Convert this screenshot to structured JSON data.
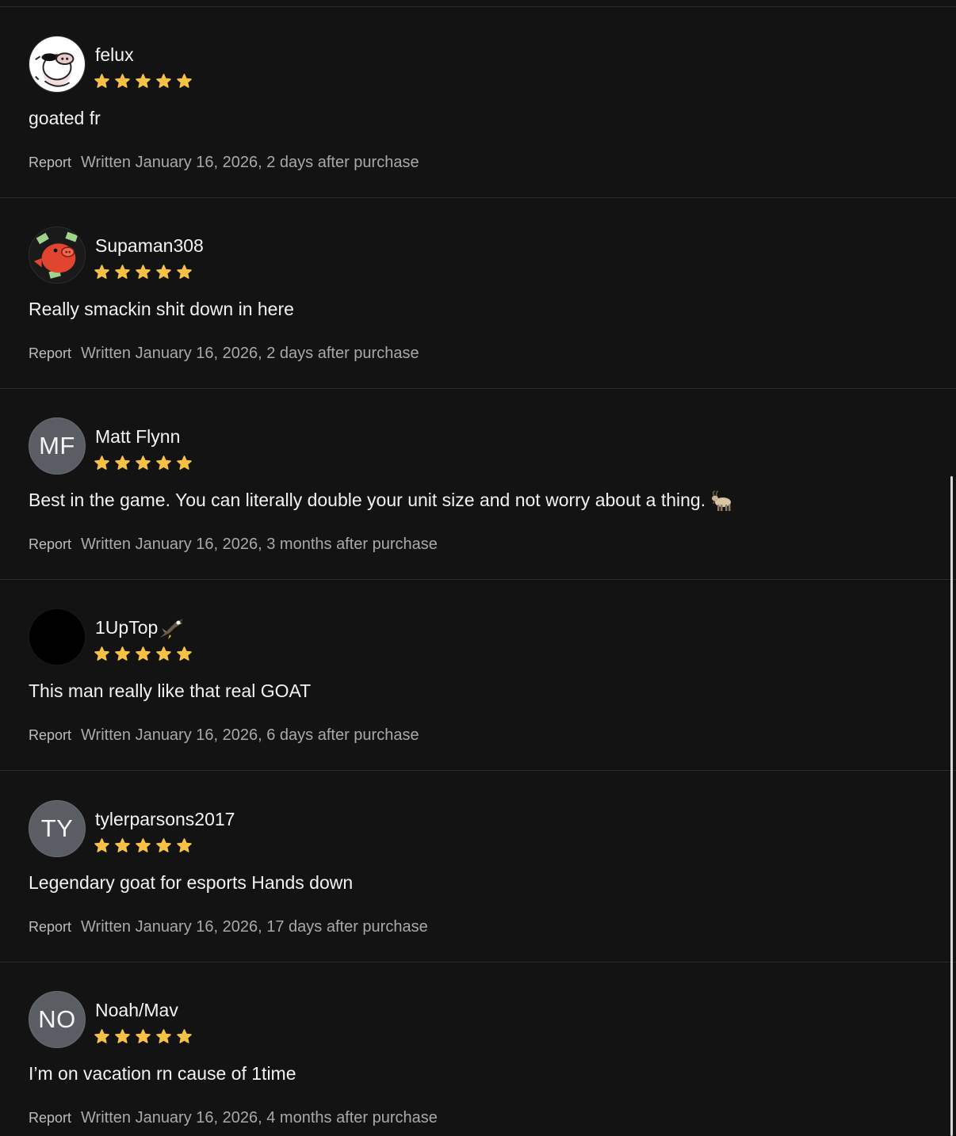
{
  "reviews": [
    {
      "name": "felux",
      "avatar": {
        "type": "image",
        "icon": "cow-avatar-icon"
      },
      "rating": 5,
      "body": "goated fr",
      "report_label": "Report",
      "written": "Written January 16, 2026, 2 days after purchase"
    },
    {
      "name": "Supaman308",
      "avatar": {
        "type": "image",
        "icon": "pig-money-avatar-icon"
      },
      "rating": 5,
      "body": "Really smackin shit down in here",
      "report_label": "Report",
      "written": "Written January 16, 2026, 2 days after purchase"
    },
    {
      "name": "Matt Flynn",
      "avatar": {
        "type": "initials",
        "initials": "MF"
      },
      "rating": 5,
      "body": "Best in the game. You can literally double your unit size and not worry about a thing.",
      "body_icon": "goat-emoji-icon",
      "report_label": "Report",
      "written": "Written January 16, 2026, 3 months after purchase"
    },
    {
      "name": "1UpTop",
      "name_icon": "eagle-emoji-icon",
      "avatar": {
        "type": "image",
        "icon": "black-circle-avatar-icon"
      },
      "rating": 5,
      "body": "This man really like that real GOAT",
      "report_label": "Report",
      "written": "Written January 16, 2026, 6 days after purchase"
    },
    {
      "name": "tylerparsons2017",
      "avatar": {
        "type": "initials",
        "initials": "TY"
      },
      "rating": 5,
      "body": "Legendary goat for esports Hands down",
      "report_label": "Report",
      "written": "Written January 16, 2026, 17 days after purchase"
    },
    {
      "name": "Noah/Mav",
      "avatar": {
        "type": "initials",
        "initials": "NO"
      },
      "rating": 5,
      "body": "I’m on vacation rn cause of 1time",
      "report_label": "Report",
      "written": "Written January 16, 2026, 4 months after purchase"
    }
  ],
  "colors": {
    "background": "#131313",
    "divider": "#2c2c2c",
    "star": "#f7c244",
    "initials_avatar": "#5a5d63",
    "meta_text": "#a9a9a9"
  }
}
